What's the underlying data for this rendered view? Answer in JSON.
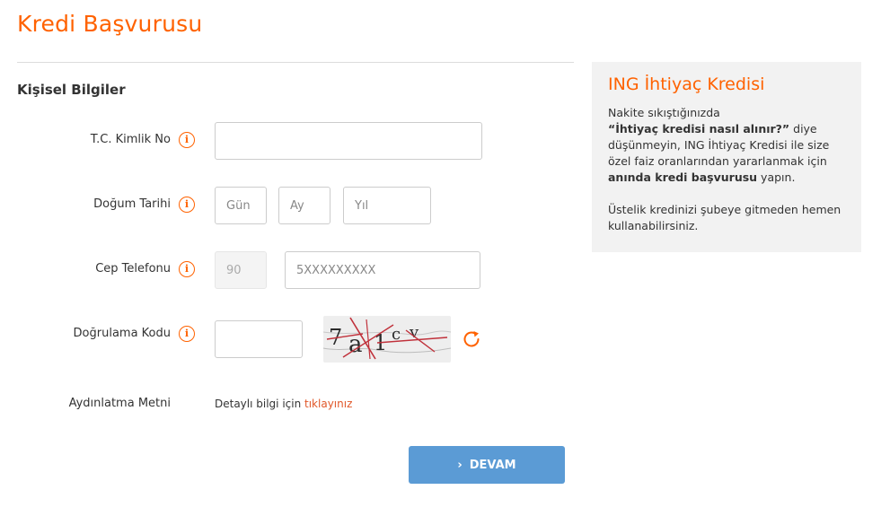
{
  "page": {
    "title": "Kredi Başvurusu",
    "section_title": "Kişisel Bilgiler"
  },
  "form": {
    "tc": {
      "label": "T.C. Kimlik No",
      "value": ""
    },
    "dogum": {
      "label": "Doğum Tarihi",
      "gun_placeholder": "Gün",
      "ay_placeholder": "Ay",
      "yil_placeholder": "Yıl"
    },
    "telefon": {
      "label": "Cep Telefonu",
      "country_code": "90",
      "phone_placeholder": "5XXXXXXXXX"
    },
    "dogrulama": {
      "label": "Doğrulama Kodu",
      "value": "",
      "captcha_text": "7a1cv"
    },
    "aydinlatma": {
      "label": "Aydınlatma Metni",
      "text": "Detaylı bilgi için ",
      "link": "tıklayınız"
    },
    "submit_label": "DEVAM"
  },
  "side": {
    "title": "ING İhtiyaç Kredisi",
    "p1_a": "Nakite sıkıştığınızda",
    "p1_b": "“İhtiyaç kredisi nasıl alınır?”",
    "p1_c": " diye düşünmeyin, ING İhtiyaç Kredisi ile size özel faiz oranlarından yararlanmak için ",
    "p1_d": "anında kredi başvurusu",
    "p1_e": " yapın.",
    "p2": "Üstelik kredinizi şubeye gitmeden hemen kullanabilirsiniz."
  },
  "colors": {
    "accent": "#ff6200",
    "button": "#5b9bd5",
    "link": "#e1582a"
  },
  "icons": {
    "info": "info-icon",
    "refresh": "refresh-icon",
    "chevron": "chevron-right-icon"
  }
}
